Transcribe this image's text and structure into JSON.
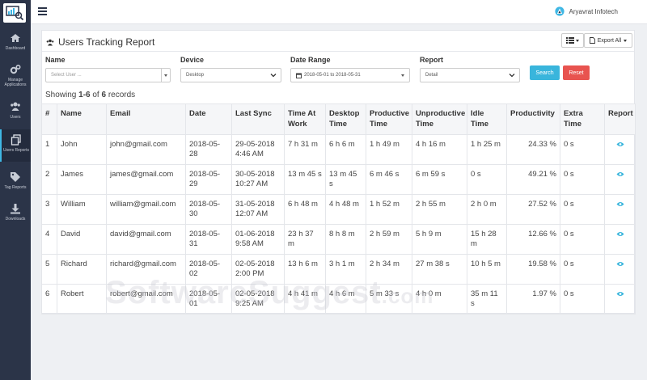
{
  "sidebar": {
    "items": [
      {
        "label": "Dashboard",
        "icon": "home-icon"
      },
      {
        "label": "Manage Applications",
        "icon": "gears-icon"
      },
      {
        "label": "Users",
        "icon": "users-icon"
      },
      {
        "label": "Users Reports",
        "icon": "report-icon"
      },
      {
        "label": "Tag Reports",
        "icon": "tags-icon"
      },
      {
        "label": "Downloads",
        "icon": "download-icon"
      }
    ]
  },
  "topbar": {
    "company": "Aryavrat Infotech"
  },
  "panel": {
    "title": "Users Tracking Report",
    "export_label": "Export All"
  },
  "filters": {
    "name_label": "Name",
    "name_placeholder": "Select User ...",
    "device_label": "Device",
    "device_value": "Desktop",
    "date_label": "Date Range",
    "date_value": "2018-05-01 to 2018-05-31",
    "report_label": "Report",
    "report_value": "Detail",
    "search_label": "Search",
    "reset_label": "Reset"
  },
  "showing": {
    "prefix": "Showing ",
    "range": "1-6",
    "of": " of ",
    "total": "6",
    "suffix": " records"
  },
  "table": {
    "headers": [
      "#",
      "Name",
      "Email",
      "Date",
      "Last Sync",
      "Time At Work",
      "Desktop Time",
      "Productive Time",
      "Unproductive Time",
      "Idle Time",
      "Productivity",
      "Extra Time",
      "Report"
    ],
    "rows": [
      [
        "1",
        "John",
        "john@gmail.com",
        "2018-05-28",
        "29-05-2018 4:46 AM",
        "7 h 31 m",
        "6 h 6 m",
        "1 h 49 m",
        "4 h 16 m",
        "1 h 25 m",
        "24.33 %",
        "0 s"
      ],
      [
        "2",
        "James",
        "james@gmail.com",
        "2018-05-29",
        "30-05-2018 10:27 AM",
        "13 m 45 s",
        "13 m 45 s",
        "6 m 46 s",
        "6 m 59 s",
        "0 s",
        "49.21 %",
        "0 s"
      ],
      [
        "3",
        "William",
        "william@gmail.com",
        "2018-05-30",
        "31-05-2018 12:07 AM",
        "6 h 48 m",
        "4 h 48 m",
        "1 h 52 m",
        "2 h 55 m",
        "2 h 0 m",
        "27.52 %",
        "0 s"
      ],
      [
        "4",
        "David",
        "david@gmail.com",
        "2018-05-31",
        "01-06-2018 9:58 AM",
        "23 h 37 m",
        "8 h 8 m",
        "2 h 59 m",
        "5 h 9 m",
        "15 h 28 m",
        "12.66 %",
        "0 s"
      ],
      [
        "5",
        "Richard",
        "richard@gmail.com",
        "2018-05-02",
        "02-05-2018 2:00 PM",
        "13 h 6 m",
        "3 h 1 m",
        "2 h 34 m",
        "27 m 38 s",
        "10 h 5 m",
        "19.58 %",
        "0 s"
      ],
      [
        "6",
        "Robert",
        "robert@gmail.com",
        "2018-05-01",
        "02-05-2018 9:25 AM",
        "4 h 41 m",
        "4 h 6 m",
        "5 m 33 s",
        "4 h 0 m",
        "35 m 11 s",
        "1.97 %",
        "0 s"
      ]
    ]
  },
  "watermark": {
    "main": "SoftwareSuggest",
    "suffix": ".com"
  },
  "colors": {
    "sidebar": "#2b3448",
    "accent": "#3fb7e4",
    "search": "#39b5dc",
    "reset": "#e8534f"
  }
}
